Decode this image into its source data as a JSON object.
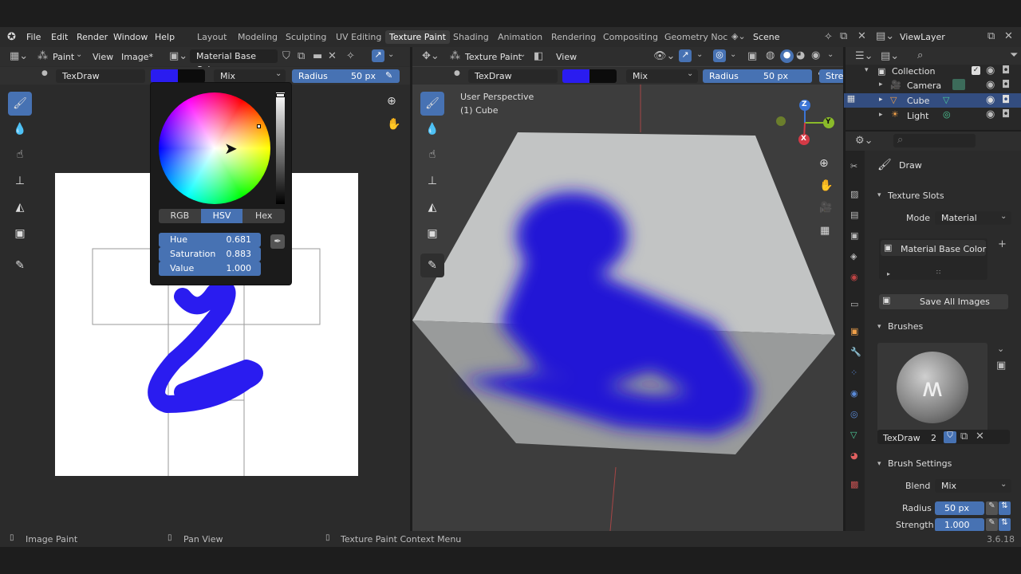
{
  "menu": [
    "File",
    "Edit",
    "Render",
    "Window",
    "Help"
  ],
  "workspaces": [
    "Layout",
    "Modeling",
    "Sculpting",
    "UV Editing",
    "Texture Paint",
    "Shading",
    "Animation",
    "Rendering",
    "Compositing",
    "Geometry Noc"
  ],
  "active_workspace": "Texture Paint",
  "scene": "Scene",
  "view_layer": "ViewLayer",
  "image_editor": {
    "mode": "Paint",
    "view_menu": "View",
    "image_menu": "Image*",
    "image_name": "Material Base Color",
    "brush": "TexDraw",
    "blend": "Mix",
    "radius_label": "Radius",
    "radius_value": "50 px"
  },
  "color_picker": {
    "tabs": [
      "RGB",
      "HSV",
      "Hex"
    ],
    "active_tab": "HSV",
    "hue_label": "Hue",
    "hue": "0.681",
    "sat_label": "Saturation",
    "sat": "0.883",
    "val_label": "Value",
    "val": "1.000",
    "color": "#2a1cf0"
  },
  "viewport": {
    "mode": "Texture Paint",
    "view_menu": "View",
    "brush": "TexDraw",
    "blend": "Mix",
    "radius_label": "Radius",
    "radius_value": "50 px",
    "strength_cut": "Stre",
    "perspective": "User Perspective",
    "object": "(1) Cube",
    "gizmo": {
      "z": "Z",
      "y": "Y",
      "x": "X"
    }
  },
  "outliner": {
    "collection": "Collection",
    "items": [
      "Camera",
      "Cube",
      "Light"
    ]
  },
  "properties": {
    "tool": "Draw",
    "texture_slots": "Texture Slots",
    "mode_label": "Mode",
    "mode_value": "Material",
    "slot_name": "Material Base Color",
    "save_all": "Save All Images",
    "brushes": "Brushes",
    "brush_name": "TexDraw",
    "brush_users": "2",
    "brush_settings": "Brush Settings",
    "blend_label": "Blend",
    "blend_value": "Mix",
    "radius_label": "Radius",
    "radius_value": "50 px",
    "strength_label": "Strength",
    "strength_value": "1.000"
  },
  "statusbar": {
    "left": "Image Paint",
    "mid": "Pan View",
    "right": "Texture Paint Context Menu",
    "version": "3.6.18"
  },
  "colors": {
    "accent": "#4772b3",
    "paint": "#2a1cf0",
    "background": "#1d1d1d"
  }
}
